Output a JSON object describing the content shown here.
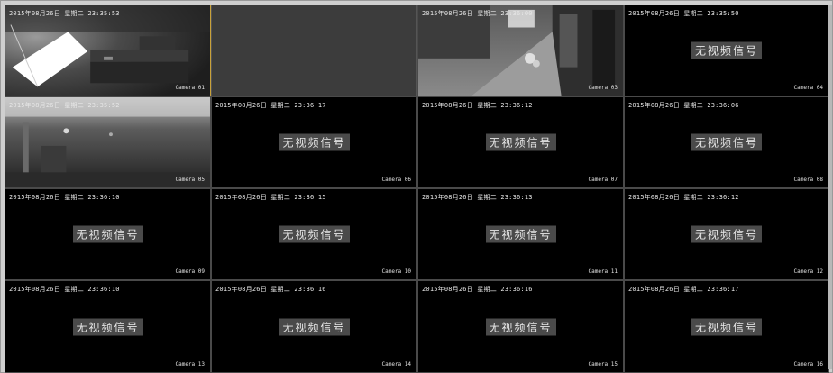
{
  "tiles": [
    {
      "time": "2015年08月26日 星期二 23:35:53",
      "camera": "Camera 01",
      "state": "live",
      "scene": "room-dark",
      "selected": true
    },
    {
      "time": "",
      "camera": "",
      "state": "empty"
    },
    {
      "time": "2015年08月26日 星期二 23:36:00",
      "camera": "Camera 03",
      "state": "live",
      "scene": "alley"
    },
    {
      "time": "2015年08月26日 星期二 23:35:50",
      "camera": "Camera 04",
      "state": "no-signal",
      "message": "无视频信号"
    },
    {
      "time": "2015年08月26日 星期二 23:35:52",
      "camera": "Camera 05",
      "state": "live",
      "scene": "corridor"
    },
    {
      "time": "2015年08月26日 星期二 23:36:17",
      "camera": "Camera 06",
      "state": "no-signal",
      "message": "无视频信号"
    },
    {
      "time": "2015年08月26日 星期二 23:36:12",
      "camera": "Camera 07",
      "state": "no-signal",
      "message": "无视频信号"
    },
    {
      "time": "2015年08月26日 星期二 23:36:06",
      "camera": "Camera 08",
      "state": "no-signal",
      "message": "无视频信号"
    },
    {
      "time": "2015年08月26日 星期二 23:36:10",
      "camera": "Camera 09",
      "state": "no-signal",
      "message": "无视频信号"
    },
    {
      "time": "2015年08月26日 星期二 23:36:15",
      "camera": "Camera 10",
      "state": "no-signal",
      "message": "无视频信号"
    },
    {
      "time": "2015年08月26日 星期二 23:36:13",
      "camera": "Camera 11",
      "state": "no-signal",
      "message": "无视频信号"
    },
    {
      "time": "2015年08月26日 星期二 23:36:12",
      "camera": "Camera 12",
      "state": "no-signal",
      "message": "无视频信号"
    },
    {
      "time": "2015年08月26日 星期二 23:36:10",
      "camera": "Camera 13",
      "state": "no-signal",
      "message": "无视频信号"
    },
    {
      "time": "2015年08月26日 星期二 23:36:16",
      "camera": "Camera 14",
      "state": "no-signal",
      "message": "无视频信号"
    },
    {
      "time": "2015年08月26日 星期二 23:36:16",
      "camera": "Camera 15",
      "state": "no-signal",
      "message": "无视频信号"
    },
    {
      "time": "2015年08月26日 星期二 23:36:17",
      "camera": "Camera 16",
      "state": "no-signal",
      "message": "无视频信号"
    }
  ],
  "colors": {
    "selected_border": "#c9a23a",
    "no_signal_bg": "#4a4a4a",
    "empty_tile": "#3c3c3c"
  }
}
